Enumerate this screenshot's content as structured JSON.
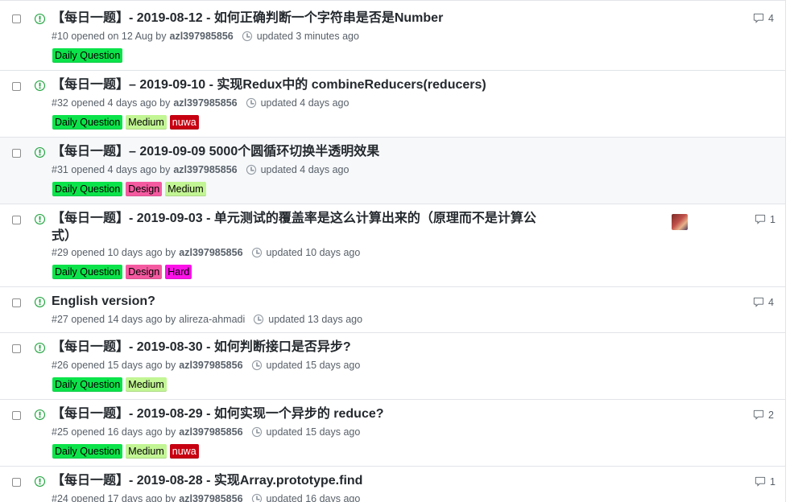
{
  "colors": {
    "open_icon": "#28a745",
    "daily_question": "#0be34a",
    "medium": "#c2f594",
    "design": "#f45aa0",
    "nuwa": "#c70011",
    "hard": "#fb12e7"
  },
  "icons": {
    "state": "issue-opened-icon",
    "updated": "clock-icon",
    "comments": "comment-icon"
  },
  "issues": [
    {
      "title": "【每日一题】- 2019-08-12 - 如何正确判断一个字符串是否是Number",
      "opened": "#10 opened on 12 Aug by",
      "author": "azl397985856",
      "updated": "updated 3 minutes ago",
      "labels": [
        {
          "text": "Daily Question"
        }
      ],
      "comments": "4"
    },
    {
      "title": "【每日一题】– 2019-09-10 - 实现Redux中的 combineReducers(reducers)",
      "opened": "#32 opened 4 days ago by",
      "author": "azl397985856",
      "updated": "updated 4 days ago",
      "labels": [
        {
          "text": "Daily Question"
        },
        {
          "text": "Medium"
        },
        {
          "text": "nuwa"
        }
      ],
      "comments": ""
    },
    {
      "title": "【每日一题】– 2019-09-09 5000个圆循环切换半透明效果",
      "opened": "#31 opened 4 days ago by",
      "author": "azl397985856",
      "updated": "updated 4 days ago",
      "labels": [
        {
          "text": "Daily Question"
        },
        {
          "text": "Design"
        },
        {
          "text": "Medium"
        }
      ],
      "comments": ""
    },
    {
      "title": "【每日一题】- 2019-09-03 - 单元测试的覆盖率是这么计算出来的（原理而不是计算公式）",
      "opened": "#29 opened 10 days ago by",
      "author": "azl397985856",
      "updated": "updated 10 days ago",
      "labels": [
        {
          "text": "Daily Question"
        },
        {
          "text": "Design"
        },
        {
          "text": "Hard"
        }
      ],
      "comments": "1"
    },
    {
      "title": "English version?",
      "opened": "#27 opened 14 days ago by",
      "author": "alireza-ahmadi",
      "updated": "updated 13 days ago",
      "labels": [],
      "comments": "4"
    },
    {
      "title": "【每日一题】- 2019-08-30 - 如何判断接口是否异步?",
      "opened": "#26 opened 15 days ago by",
      "author": "azl397985856",
      "updated": "updated 15 days ago",
      "labels": [
        {
          "text": "Daily Question"
        },
        {
          "text": "Medium"
        }
      ],
      "comments": ""
    },
    {
      "title": "【每日一题】- 2019-08-29 - 如何实现一个异步的 reduce?",
      "opened": "#25 opened 16 days ago by",
      "author": "azl397985856",
      "updated": "updated 15 days ago",
      "labels": [
        {
          "text": "Daily Question"
        },
        {
          "text": "Medium"
        },
        {
          "text": "nuwa"
        }
      ],
      "comments": "2"
    },
    {
      "title": "【每日一题】- 2019-08-28 - 实现Array.prototype.find",
      "opened": "#24 opened 17 days ago by",
      "author": "azl397985856",
      "updated": "updated 16 days ago",
      "labels": [],
      "comments": "1"
    }
  ]
}
